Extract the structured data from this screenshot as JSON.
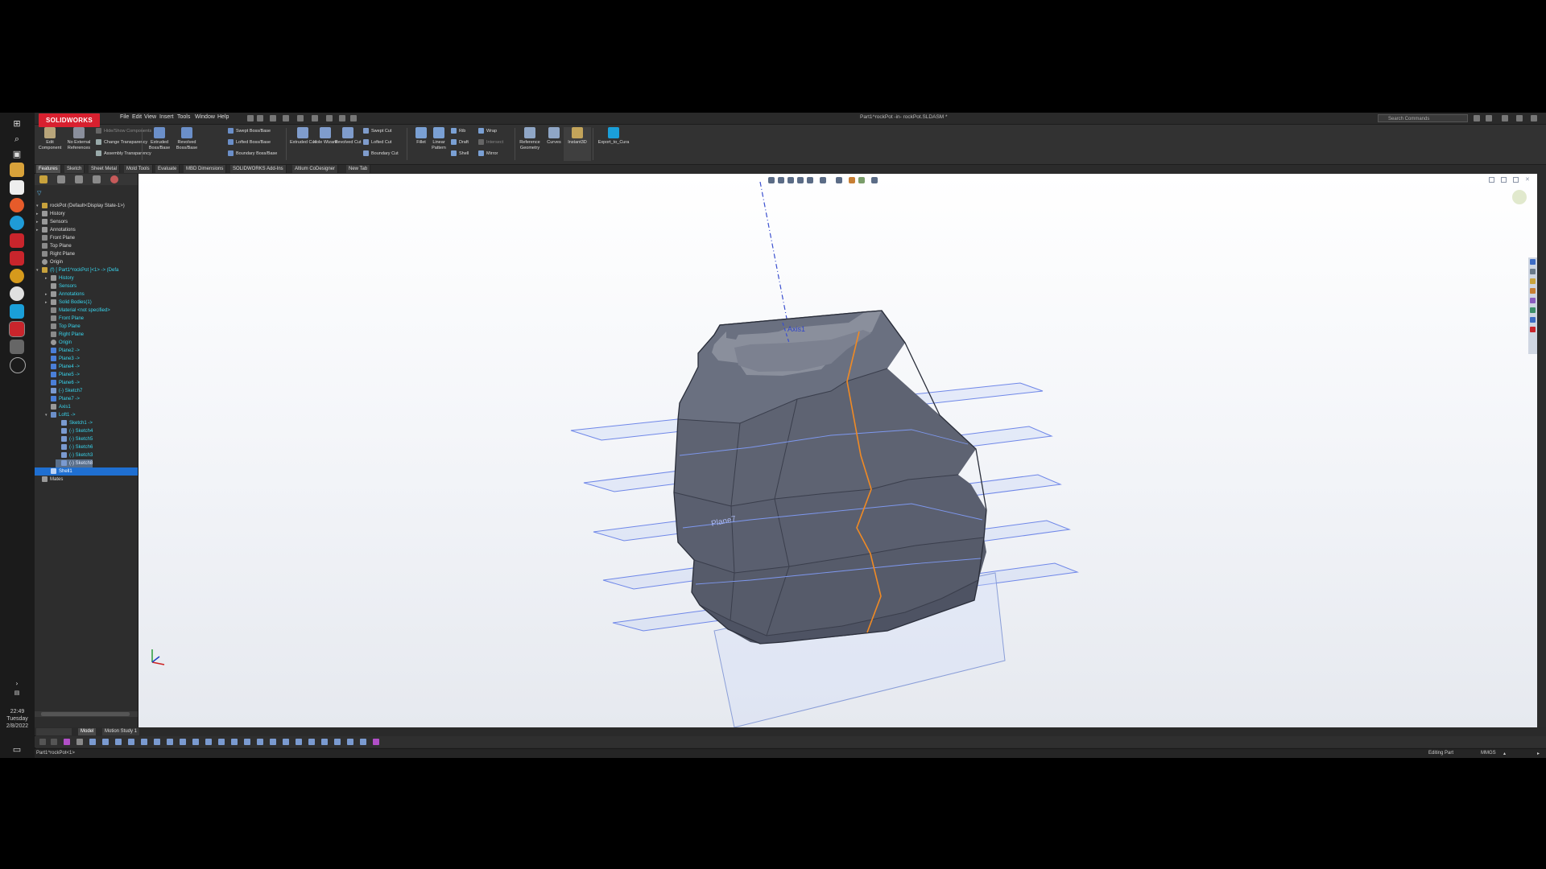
{
  "window": {
    "app_brand": "SOLIDWORKS",
    "title": "Part1^rockPot -in- rockPot.SLDASM *",
    "menus": [
      "File",
      "Edit",
      "View",
      "Insert",
      "Tools",
      "Window",
      "Help"
    ],
    "search_placeholder": "Search Commands"
  },
  "taskbar": {
    "time": "22:49",
    "day": "Tuesday",
    "date": "2/8/2022"
  },
  "ribbon": {
    "edit_component": "Edit Component",
    "no_external_refs": "No External References",
    "hide_show_components": "Hide/Show Components",
    "change_transparency": "Change Transparency",
    "assembly_transparency": "Assembly Transparency",
    "extruded_boss": "Extruded Boss/Base",
    "revolved_boss": "Revolved Boss/Base",
    "swept_boss": "Swept Boss/Base",
    "lofted_boss": "Lofted Boss/Base",
    "boundary_boss": "Boundary Boss/Base",
    "extruded_cut": "Extruded Cut",
    "hole_wizard": "Hole Wizard",
    "revolved_cut": "Revolved Cut",
    "swept_cut": "Swept Cut",
    "lofted_cut": "Lofted Cut",
    "boundary_cut": "Boundary Cut",
    "fillet": "Fillet",
    "linear_pattern": "Linear Pattern",
    "rib": "Rib",
    "draft": "Draft",
    "shell": "Shell",
    "wrap": "Wrap",
    "intersect": "Intersect",
    "mirror": "Mirror",
    "reference_geometry": "Reference Geometry",
    "curves": "Curves",
    "instant3d": "Instant3D",
    "export_to_cura": "Export_to_Cura"
  },
  "tabs": [
    "Features",
    "Sketch",
    "Sheet Metal",
    "Mold Tools",
    "Evaluate",
    "MBD Dimensions",
    "SOLIDWORKS Add-Ins",
    "Altium CoDesigner",
    "New Tab"
  ],
  "tree": {
    "root": "rockPot (Default<Display State-1>)",
    "top_items": [
      "History",
      "Sensors",
      "Annotations",
      "Front Plane",
      "Top Plane",
      "Right Plane",
      "Origin"
    ],
    "component": "(f) [ Part1^rockPot ]<1> -> (Defa",
    "component_items": [
      "History",
      "Sensors",
      "Annotations",
      "Solid Bodies(1)",
      "Material <not specified>",
      "Front Plane",
      "Top Plane",
      "Right Plane",
      "Origin",
      "Plane2 ->",
      "Plane3 ->",
      "Plane4 ->",
      "Plane5 ->",
      "Plane6 ->",
      "(-) Sketch7",
      "Plane7 ->",
      "Axis1",
      "Loft1 ->"
    ],
    "loft_children": [
      "Sketch1 ->",
      "(-) Sketch4",
      "(-) Sketch5",
      "(-) Sketch6",
      "(-) Sketch3",
      "(-) Sketch8"
    ],
    "shell": "Shell1",
    "mates": "Mates"
  },
  "viewport": {
    "axis_label": "Axis1",
    "plane_label": "Plane7"
  },
  "bottom_tabs": [
    "Model",
    "Motion Study 1"
  ],
  "status": {
    "left": "Part1^rockPot<1>",
    "mode": "Editing Part",
    "units": "MMGS"
  },
  "colors": {
    "brand_red": "#d8202f",
    "tree_highlight": "#38d6ef",
    "selection_blue": "#1f6fd1",
    "edge_orange": "#f08a24",
    "plane_blue": "#6f87e8",
    "body_gray": "#5e6372"
  }
}
